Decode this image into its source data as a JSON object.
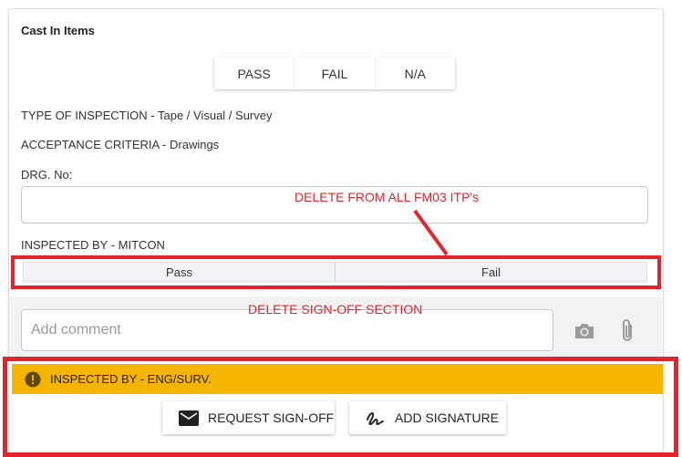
{
  "section": {
    "title": "Cast In Items"
  },
  "result_toggle": {
    "pass": "PASS",
    "fail": "FAIL",
    "na": "N/A"
  },
  "info": {
    "type_of_inspection": "TYPE OF INSPECTION - Tape / Visual / Survey",
    "acceptance_criteria": "ACCEPTANCE CRITERIA - Drawings",
    "drg_no_label": "DRG. No:",
    "drg_no_value": "",
    "inspected_by": "INSPECTED BY - MITCON"
  },
  "annotations": {
    "delete_from_itps": "DELETE FROM ALL FM03 ITP's",
    "delete_signoff": "DELETE SIGN-OFF SECTION",
    "color": "#e5232d"
  },
  "pass_fail": {
    "pass": "Pass",
    "fail": "Fail"
  },
  "comment": {
    "placeholder": "Add comment"
  },
  "signoff": {
    "label": "INSPECTED BY - ENG/SURV.",
    "color": "#f5b400",
    "request_button": "REQUEST SIGN-OFF",
    "signature_button": "ADD SIGNATURE"
  },
  "icons": [
    "camera-icon",
    "paperclip-icon",
    "warning-icon",
    "mail-icon",
    "signature-icon"
  ]
}
